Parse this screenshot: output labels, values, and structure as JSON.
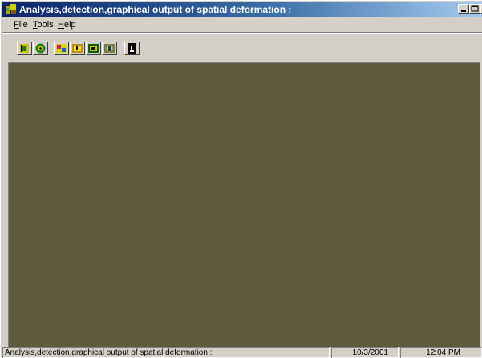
{
  "window": {
    "title": "Analysis,detection,graphical output of spatial deformation :"
  },
  "menu": {
    "items": [
      {
        "label_first": "F",
        "label_rest": "ile"
      },
      {
        "label_first": "T",
        "label_rest": "ools"
      },
      {
        "label_first": "H",
        "label_rest": "elp"
      }
    ]
  },
  "toolbar": {
    "buttons": [
      {
        "icon": "tool-icon"
      },
      {
        "icon": "globe-icon"
      },
      {
        "icon": "chart-icon"
      },
      {
        "icon": "detect-icon"
      },
      {
        "icon": "graph-icon"
      },
      {
        "icon": "map-icon"
      },
      {
        "icon": "exit-icon"
      }
    ]
  },
  "statusbar": {
    "message": "Analysis,detection,graphical output of spatial deformation :",
    "date": "10/3/2001",
    "time": "12:04 PM"
  },
  "colors": {
    "title_start": "#0a246a",
    "title_end": "#a6caf0",
    "client_bg": "#5d5a3e",
    "chrome": "#d4d0c8"
  }
}
